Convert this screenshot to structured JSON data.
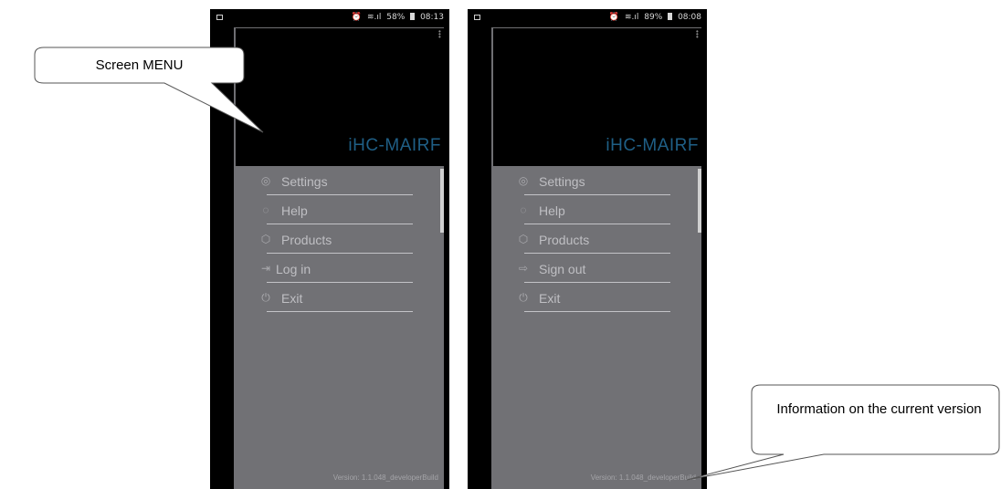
{
  "callouts": {
    "menu": "Screen MENU",
    "version": "Information on the current version"
  },
  "screens": [
    {
      "status": {
        "alarm": "⏰",
        "signal": "📶",
        "battery_pct": "58%",
        "time": "08:13"
      },
      "app_title": "iHC-MAIRF",
      "menu": [
        {
          "icon": "settings-icon",
          "label": "Settings"
        },
        {
          "icon": "help-icon",
          "label": "Help"
        },
        {
          "icon": "products-icon",
          "label": "Products"
        },
        {
          "icon": "login-icon",
          "label": "Log in"
        },
        {
          "icon": "exit-icon",
          "label": "Exit"
        }
      ],
      "version": "Version: 1.1.048_developerBuild"
    },
    {
      "status": {
        "alarm": "⏰",
        "signal": "📶",
        "battery_pct": "89%",
        "time": "08:08"
      },
      "app_title": "iHC-MAIRF",
      "menu": [
        {
          "icon": "settings-icon",
          "label": "Settings"
        },
        {
          "icon": "help-icon",
          "label": "Help"
        },
        {
          "icon": "products-icon",
          "label": "Products"
        },
        {
          "icon": "sign-out-icon",
          "label": "Sign out"
        },
        {
          "icon": "exit-icon",
          "label": "Exit"
        }
      ],
      "version": "Version: 1.1.048_developerBuild"
    }
  ],
  "colors": {
    "drawer_bg": "#717175",
    "header_bg": "#000000",
    "title": "#1f5f86",
    "menu_text": "#bfbfc3"
  }
}
